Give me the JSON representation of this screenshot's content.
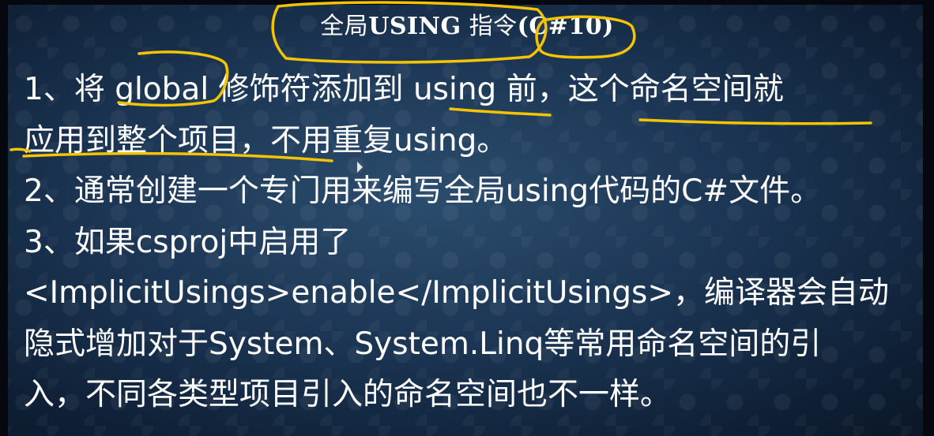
{
  "slide": {
    "title_part1": "全局",
    "title_keyword": "USING",
    "title_part2": " 指令",
    "title_part3": "(C#10)",
    "lines": [
      "1、将 global 修饰符添加到 using 前，这个命名空间就",
      "应用到整个项目，不用重复using。",
      "2、通常创建一个专门用来编写全局using代码的C#文件。",
      "3、如果csproj中启用了",
      "<ImplicitUsings>enable</ImplicitUsings>，编译器会自动",
      "隐式增加对于System、System.Linq等常用命名空间的引",
      "入，不同各类型项目引入的命名空间也不一样。"
    ]
  },
  "colors": {
    "text": "#ffffff",
    "annotation": "#f5c400",
    "background": "#1b3553"
  },
  "icons": {
    "cursor": "mouse-pointer-icon"
  }
}
